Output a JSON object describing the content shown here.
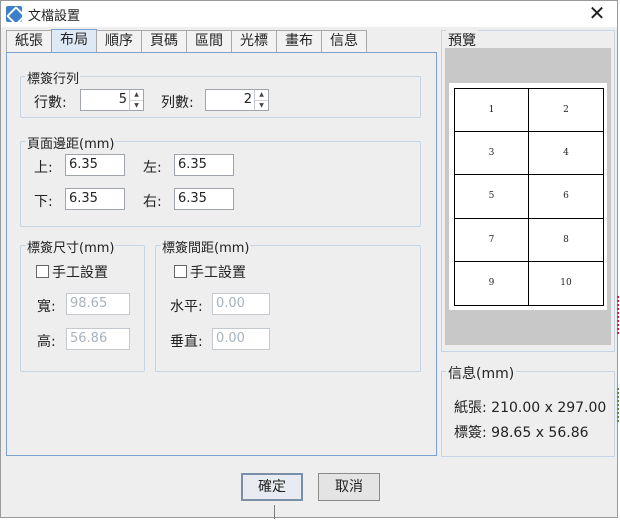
{
  "window": {
    "title": "文檔設置",
    "close_symbol": "✕"
  },
  "tabs": [
    "紙張",
    "布局",
    "順序",
    "頁碼",
    "區間",
    "光標",
    "畫布",
    "信息"
  ],
  "label_rows_cols": {
    "title": "標簽行列",
    "rows_label": "行數:",
    "rows_value": "5",
    "cols_label": "列數:",
    "cols_value": "2"
  },
  "page_margins": {
    "title": "頁面邊距(mm)",
    "top_label": "上:",
    "top_value": "6.35",
    "left_label": "左:",
    "left_value": "6.35",
    "bottom_label": "下:",
    "bottom_value": "6.35",
    "right_label": "右:",
    "right_value": "6.35"
  },
  "label_size": {
    "title": "標簽尺寸(mm)",
    "manual_label": "手工設置",
    "width_label": "寬:",
    "width_value": "98.65",
    "height_label": "高:",
    "height_value": "56.86"
  },
  "label_spacing": {
    "title": "標簽間距(mm)",
    "manual_label": "手工設置",
    "horizontal_label": "水平:",
    "horizontal_value": "0.00",
    "vertical_label": "垂直:",
    "vertical_value": "0.00"
  },
  "preview": {
    "title": "預覽",
    "cells": [
      "1",
      "2",
      "3",
      "4",
      "5",
      "6",
      "7",
      "8",
      "9",
      "10"
    ]
  },
  "info": {
    "title": "信息(mm)",
    "paper_label": "紙張:",
    "paper_value": "210.00 x 297.00",
    "label_label": "標簽:",
    "label_value": "98.65 x 56.86"
  },
  "buttons": {
    "ok": "確定",
    "cancel": "取消"
  },
  "colors": {
    "tab_active": "#dfe9f5",
    "panel_border": "#7aa1d0",
    "disabled_text": "#a8b2bd"
  }
}
